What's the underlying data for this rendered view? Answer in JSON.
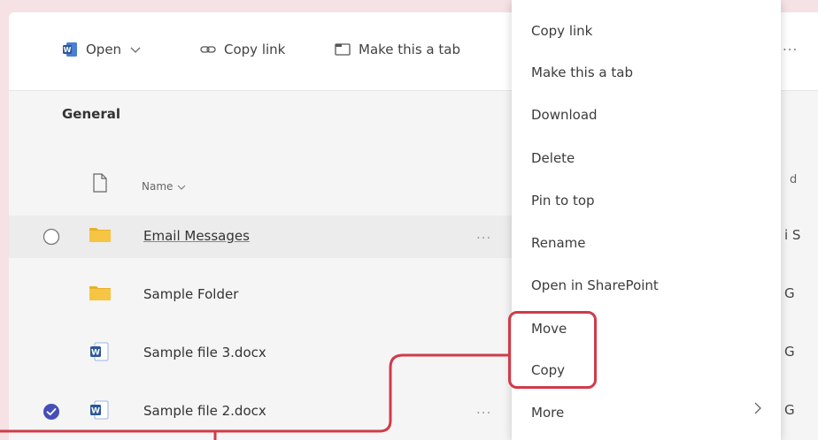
{
  "toolbar": {
    "open_label": "Open",
    "copy_link_label": "Copy link",
    "make_tab_label": "Make this a tab",
    "overflow_label": "..."
  },
  "section": {
    "title": "General"
  },
  "columns": {
    "name_header": "Name",
    "right_header": "d"
  },
  "files": [
    {
      "name": "Email Messages",
      "type": "folder",
      "state": "hover"
    },
    {
      "name": "Sample Folder",
      "type": "folder",
      "state": "normal"
    },
    {
      "name": "Sample file 3.docx",
      "type": "word",
      "state": "normal"
    },
    {
      "name": "Sample file 2.docx",
      "type": "word",
      "state": "checked"
    }
  ],
  "row_more_label": "...",
  "right_column": [
    "i S",
    "G",
    "G",
    "G"
  ],
  "context_menu": {
    "items": [
      "Copy link",
      "Make this a tab",
      "Download",
      "Delete",
      "Pin to top",
      "Rename",
      "Open in SharePoint",
      "Move",
      "Copy",
      "More"
    ]
  },
  "colors": {
    "accent": "#464eb8",
    "folder": "#f5c543",
    "word": "#2b579a",
    "highlight": "#d03b4a"
  }
}
